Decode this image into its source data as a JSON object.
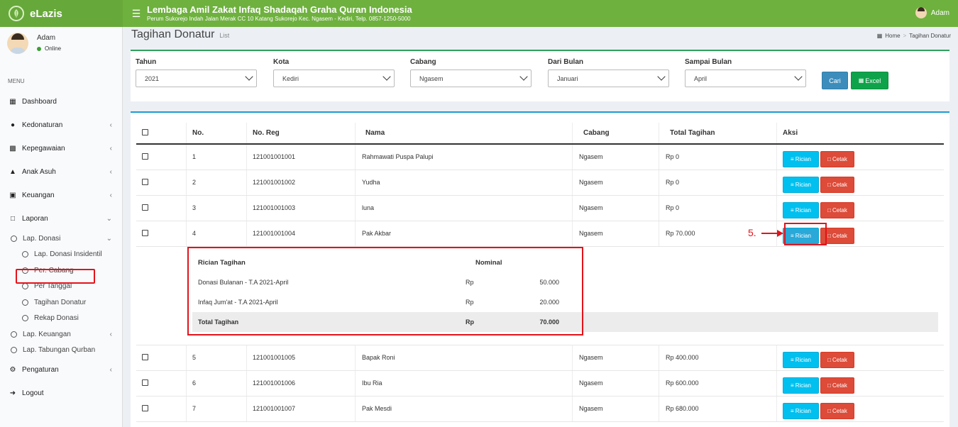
{
  "header": {
    "app_name": "eLazis",
    "org_name": "Lembaga Amil Zakat Infaq Shadaqah Graha Quran Indonesia",
    "org_address": "Perum Sukorejo Indah Jalan Merak CC 10 Katang Sukorejo Kec. Ngasem - Kediri, Telp. 0857-1250-5000",
    "user_name": "Adam",
    "bar_color": "#6eb13e"
  },
  "sidebar": {
    "user_name": "Adam",
    "status": "Online",
    "menu_header": "MENU",
    "items": {
      "dashboard": "Dashboard",
      "kedonaturan": "Kedonaturan",
      "kepegawaian": "Kepegawaian",
      "anak_asuh": "Anak Asuh",
      "keuangan": "Keuangan",
      "laporan": "Laporan",
      "pengaturan": "Pengaturan",
      "logout": "Logout"
    },
    "laporan_sub": {
      "lap_donasi": "Lap. Donasi",
      "lap_keuangan": "Lap. Keuangan",
      "lap_tabungan": "Lap. Tabungan Qurban"
    },
    "donasi_sub": {
      "insidentil": "Lap. Donasi Insidentil",
      "per_cabang": "Per. Cabang",
      "per_tanggal": "Per Tanggal",
      "tagihan": "Tagihan Donatur",
      "rekap": "Rekap Donasi"
    }
  },
  "page": {
    "title": "Tagihan Donatur",
    "subtitle": "List",
    "breadcrumb_home": "Home",
    "breadcrumb_current": "Tagihan Donatur"
  },
  "filters": {
    "tahun_label": "Tahun",
    "tahun_value": "2021",
    "kota_label": "Kota",
    "kota_value": "Kediri",
    "cabang_label": "Cabang",
    "cabang_value": "Ngasem",
    "dari_label": "Dari Bulan",
    "dari_value": "Januari",
    "sampai_label": "Sampai Bulan",
    "sampai_value": "April",
    "cari": "Cari",
    "excel": "Excel"
  },
  "table": {
    "headers": {
      "no": "No.",
      "noreg": "No. Reg",
      "nama": "Nama",
      "cabang": "Cabang",
      "total": "Total Tagihan",
      "aksi": "Aksi"
    },
    "btn_rician": "Rician",
    "btn_cetak": "Cetak",
    "rows": [
      {
        "no": "1",
        "reg": "121001001001",
        "nama": "Rahmawati Puspa Palupi",
        "cabang": "Ngasem",
        "total": "Rp 0"
      },
      {
        "no": "2",
        "reg": "121001001002",
        "nama": "Yudha",
        "cabang": "Ngasem",
        "total": "Rp 0"
      },
      {
        "no": "3",
        "reg": "121001001003",
        "nama": "luna",
        "cabang": "Ngasem",
        "total": "Rp 0"
      },
      {
        "no": "4",
        "reg": "121001001004",
        "nama": "Pak Akbar",
        "cabang": "Ngasem",
        "total": "Rp 70.000"
      },
      {
        "no": "5",
        "reg": "121001001005",
        "nama": "Bapak Roni",
        "cabang": "Ngasem",
        "total": "Rp 400.000"
      },
      {
        "no": "6",
        "reg": "121001001006",
        "nama": "Ibu Ria",
        "cabang": "Ngasem",
        "total": "Rp 600.000"
      },
      {
        "no": "7",
        "reg": "121001001007",
        "nama": "Pak Mesdi",
        "cabang": "Ngasem",
        "total": "Rp 680.000"
      }
    ]
  },
  "detail": {
    "col_rician": "Rician Tagihan",
    "col_nominal": "Nominal",
    "rows": [
      {
        "label": "Donasi Bulanan - T.A 2021-April",
        "cur": "Rp",
        "value": "50.000"
      },
      {
        "label": "Infaq Jum'at - T.A 2021-April",
        "cur": "Rp",
        "value": "20.000"
      }
    ],
    "total_label": "Total Tagihan",
    "total_cur": "Rp",
    "total_value": "70.000"
  },
  "annotation": {
    "step": "5."
  }
}
